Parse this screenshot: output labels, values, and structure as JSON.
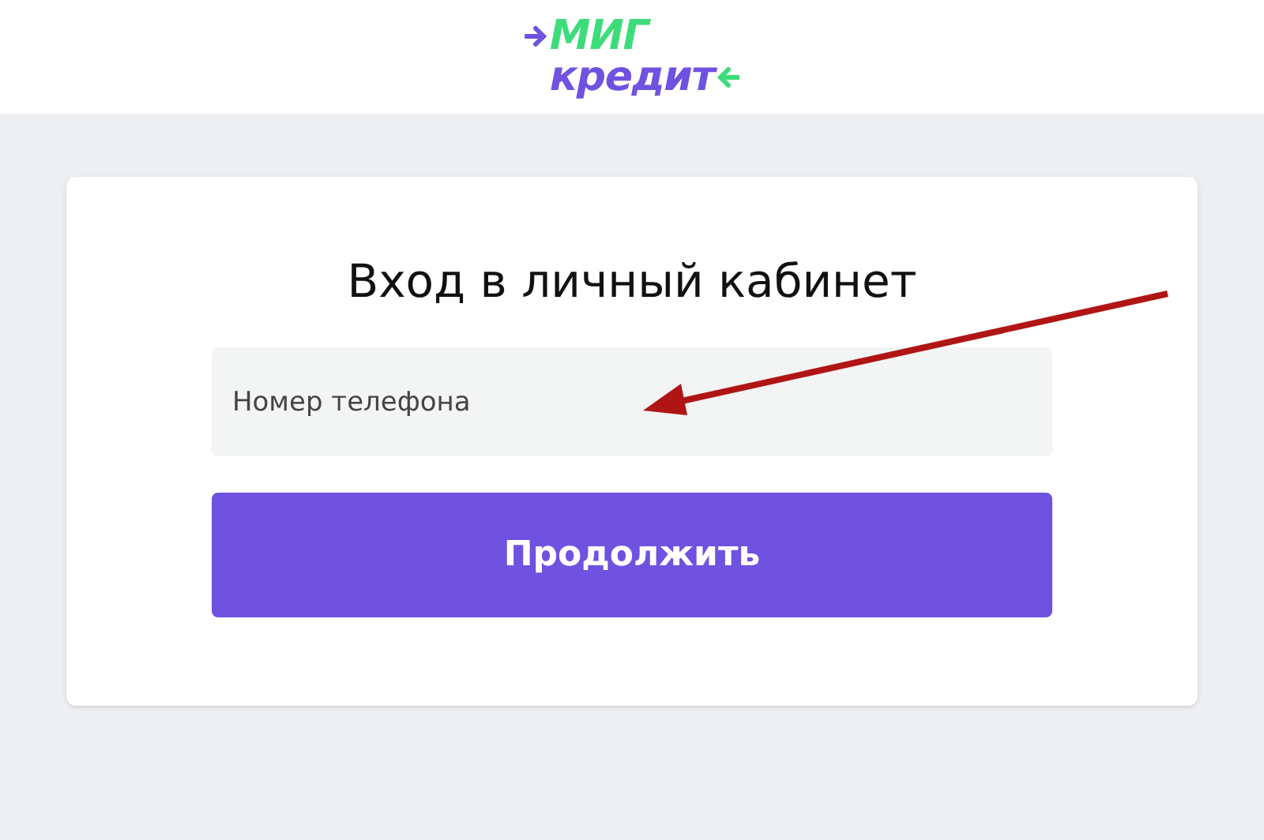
{
  "logo": {
    "top": "МИГ",
    "bottom": "кредит"
  },
  "login": {
    "title": "Вход в личный кабинет",
    "phone": {
      "placeholder": "Номер телефона"
    },
    "button": "Продолжить"
  }
}
